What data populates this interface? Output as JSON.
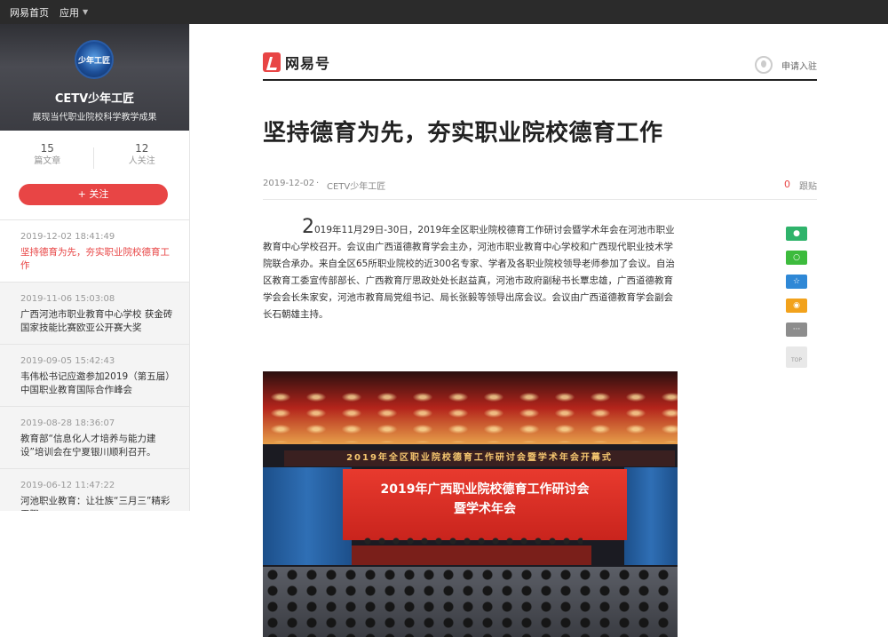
{
  "topbar": {
    "home": "网易首页",
    "apps": "应用"
  },
  "profile": {
    "avatar_text": "少年工匠",
    "name": "CETV少年工匠",
    "desc": "展现当代职业院校科学教学成果",
    "articles_count": "15",
    "articles_label": "篇文章",
    "followers_count": "12",
    "followers_label": "人关注",
    "follow_label": "+ 关注"
  },
  "article_list": [
    {
      "time": "2019-12-02 18:41:49",
      "title": "坚持德育为先，夯实职业院校德育工作"
    },
    {
      "time": "2019-11-06 15:03:08",
      "title": "广西河池市职业教育中心学校 获金砖国家技能比赛欧亚公开赛大奖"
    },
    {
      "time": "2019-09-05 15:42:43",
      "title": "韦伟松书记应邀参加2019（第五届）中国职业教育国际合作峰会"
    },
    {
      "time": "2019-08-28 18:36:07",
      "title": "教育部“信息化人才培养与能力建设”培训会在宁夏银川顺利召开。"
    },
    {
      "time": "2019-06-12 11:47:22",
      "title": "河池职业教育：让壮族“三月三”精彩无限"
    }
  ],
  "header": {
    "logo": "网易号",
    "apply": "申请入驻"
  },
  "article": {
    "title": "坚持德育为先，夯实职业院校德育工作",
    "date": "2019-12-02",
    "dot": "·",
    "source": "CETV少年工匠",
    "comments": "0",
    "follow": "跟贴",
    "dropcap": "2",
    "body": "019年11月29日-30日，2019年全区职业院校德育工作研讨会暨学术年会在河池市职业教育中心学校召开。会议由广西道德教育学会主办，河池市职业教育中心学校和广西现代职业技术学院联合承办。来自全区65所职业院校的近300名专家、学者及各职业院校领导老师参加了会议。自治区教育工委宣传部部长、广西教育厅思政处处长赵益真，河池市政府副秘书长覃忠雄，广西道德教育学会会长朱家安，河池市教育局党组书记、局长张毅等领导出席会议。会议由广西道德教育学会副会长石朝雄主持。"
  },
  "photo": {
    "banner": "2019年全区职业院校德育工作研讨会暨学术年会开幕式",
    "screen_line1": "2019年广西职业院校德育工作研讨会",
    "screen_line2": "暨学术年会"
  },
  "share": {
    "more": "···",
    "top": "TOP"
  }
}
